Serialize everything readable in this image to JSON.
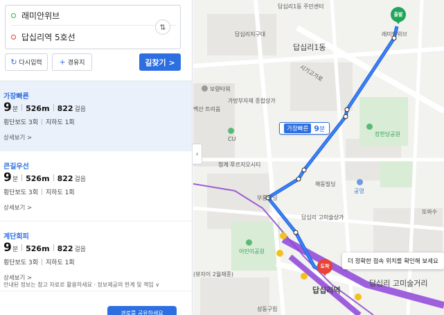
{
  "route_inputs": {
    "start": "래미안위브",
    "end": "답십리역 5호선",
    "swap_icon": "swap-arrows-icon"
  },
  "actions": {
    "reset_label": "다시입력",
    "via_label": "경유지",
    "search_label": "길찾기 >"
  },
  "results": [
    {
      "type": "가장빠른",
      "minutes": "9",
      "minutes_unit": "분",
      "distance": "526m",
      "steps": "822",
      "steps_unit": "걸음",
      "crosswalk": "횡단보도 3회",
      "underpass": "지하도 1회",
      "more": "상세보기 >"
    },
    {
      "type": "큰길우선",
      "minutes": "9",
      "minutes_unit": "분",
      "distance": "526m",
      "steps": "822",
      "steps_unit": "걸음",
      "crosswalk": "횡단보도 3회",
      "underpass": "지하도 1회",
      "more": "상세보기 >"
    },
    {
      "type": "계단회피",
      "minutes": "9",
      "minutes_unit": "분",
      "distance": "526m",
      "steps": "822",
      "steps_unit": "걸음",
      "crosswalk": "횡단보도 3회",
      "underpass": "지하도 1회",
      "more": "상세보기 >"
    }
  ],
  "notice": "안내된 정보는 참고 자료로 활용하세요 · 정보제공의 한계 및 책임 ∨",
  "floating_button": "경로를 공유하세요",
  "map": {
    "route_badge_tag": "가장빠른",
    "route_badge_minutes": "9",
    "route_badge_unit": "분",
    "start_pin": "출발",
    "end_pin": "도착",
    "tooltip": "더 정확한 접속 위치를 확인해 보세요",
    "labels": {
      "dong1_center": "답십리1동 주민센터",
      "dong1": "답십리1동",
      "raemian": "래미안위브",
      "jigudae": "답십리지구대",
      "sigwan": "시기고가로",
      "boryang": "보량타워",
      "gabang": "가방부자재 종합상가",
      "baeksan": "백산 트리움",
      "cu": "CU",
      "cheonggye": "청계 푸르지오시티",
      "janghan_park": "장한당공원",
      "haedeung": "해동빌딩",
      "gongyeong": "공영",
      "bukyeong": "부롱빌딩",
      "gomieul": "답십리 고미술상가",
      "yeolin_park": "어린이공원",
      "dapsimni_station": "답십리역",
      "gomisul_street": "답십리 고미술거리",
      "seongdong_gu": "성동구립",
      "ttowasu": "또와수",
      "vyuja": "(뷰자이 2월재종)"
    }
  }
}
